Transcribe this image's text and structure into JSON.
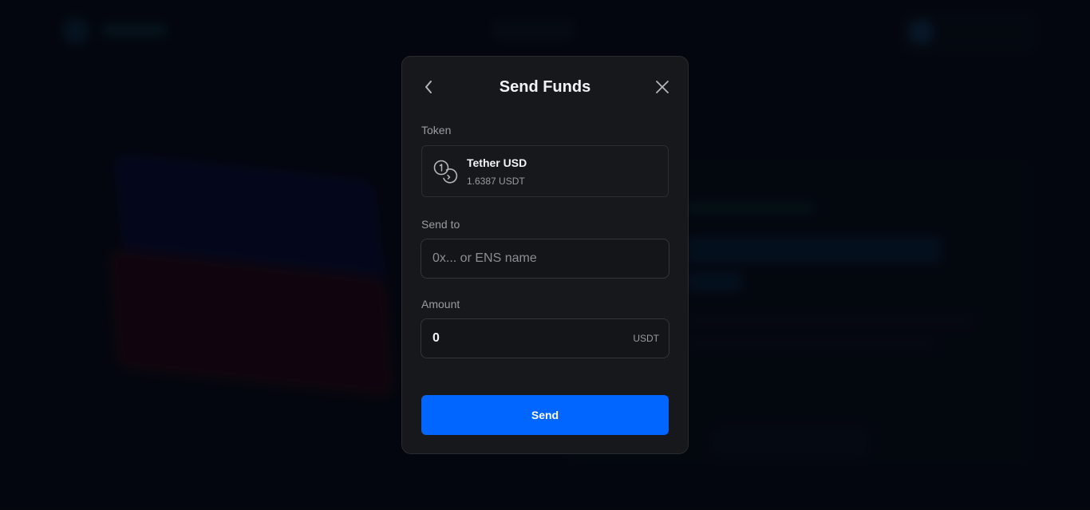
{
  "modal": {
    "title": "Send Funds",
    "back_icon": "chevron-left-icon",
    "close_icon": "close-icon"
  },
  "token": {
    "label": "Token",
    "icon": "coins-icon",
    "name": "Tether USD",
    "balance": "1.6387 USDT"
  },
  "send_to": {
    "label": "Send to",
    "placeholder": "0x... or ENS name",
    "value": ""
  },
  "amount": {
    "label": "Amount",
    "value": "0",
    "unit": "USDT"
  },
  "send_button": {
    "label": "Send"
  },
  "colors": {
    "accent": "#0066ff",
    "modal_bg": "#17181c",
    "page_bg": "#04070e"
  }
}
